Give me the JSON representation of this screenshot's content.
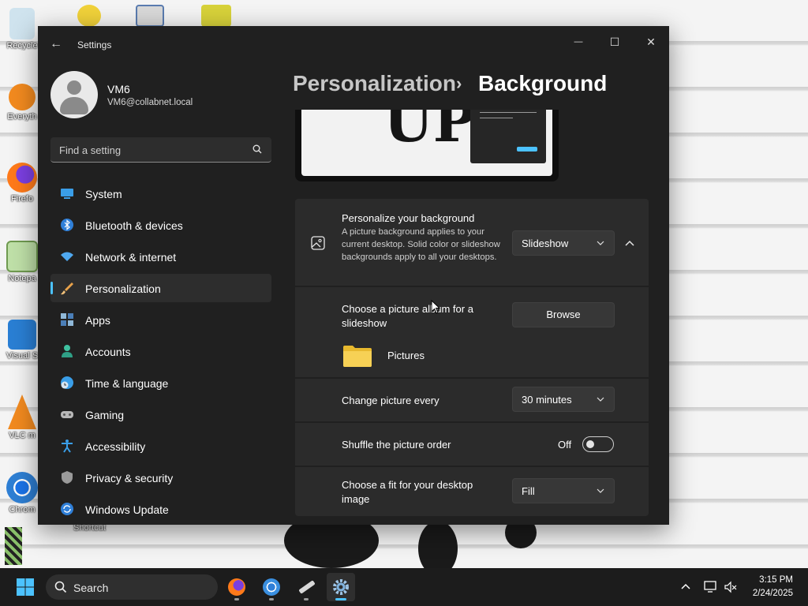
{
  "desktop": {
    "icons": [
      {
        "label": "Recycle"
      },
      {
        "label": "Everyth"
      },
      {
        "label": "Firefo"
      },
      {
        "label": "Notepa"
      },
      {
        "label": "Visual S"
      },
      {
        "label": "VLC m"
      },
      {
        "label": "Chrom"
      }
    ],
    "shortcut_label": "Shortcut"
  },
  "window": {
    "title": "Settings",
    "back_glyph": "←",
    "minimize_glyph": "—",
    "maximize_glyph": "☐",
    "close_glyph": "✕"
  },
  "profile": {
    "name": "VM6",
    "email": "VM6@collabnet.local"
  },
  "search": {
    "placeholder": "Find a setting"
  },
  "nav": {
    "items": [
      {
        "label": "System",
        "icon": "system-icon"
      },
      {
        "label": "Bluetooth & devices",
        "icon": "bluetooth-icon"
      },
      {
        "label": "Network & internet",
        "icon": "network-icon"
      },
      {
        "label": "Personalization",
        "icon": "personalization-icon",
        "active": true
      },
      {
        "label": "Apps",
        "icon": "apps-icon"
      },
      {
        "label": "Accounts",
        "icon": "accounts-icon"
      },
      {
        "label": "Time & language",
        "icon": "time-language-icon"
      },
      {
        "label": "Gaming",
        "icon": "gaming-icon"
      },
      {
        "label": "Accessibility",
        "icon": "accessibility-icon"
      },
      {
        "label": "Privacy & security",
        "icon": "privacy-icon"
      },
      {
        "label": "Windows Update",
        "icon": "windows-update-icon"
      }
    ]
  },
  "header": {
    "parent": "Personalization",
    "separator": "›",
    "current": "Background"
  },
  "preview": {
    "text": "UP."
  },
  "settings": {
    "personalize": {
      "title": "Personalize your background",
      "description": "A picture background applies to your current desktop. Solid color or slideshow backgrounds apply to all your desktops.",
      "value": "Slideshow"
    },
    "album": {
      "title": "Choose a picture album for a slideshow",
      "button": "Browse",
      "folder": "Pictures"
    },
    "interval": {
      "title": "Change picture every",
      "value": "30 minutes"
    },
    "shuffle": {
      "title": "Shuffle the picture order",
      "state": "Off"
    },
    "fit": {
      "title": "Choose a fit for your desktop image",
      "value": "Fill"
    }
  },
  "taskbar": {
    "search_placeholder": "Search",
    "time": "3:15 PM",
    "date": "2/24/2025"
  },
  "colors": {
    "accent": "#4cc2ff",
    "window_bg": "#202020",
    "card_bg": "#2b2b2b"
  }
}
